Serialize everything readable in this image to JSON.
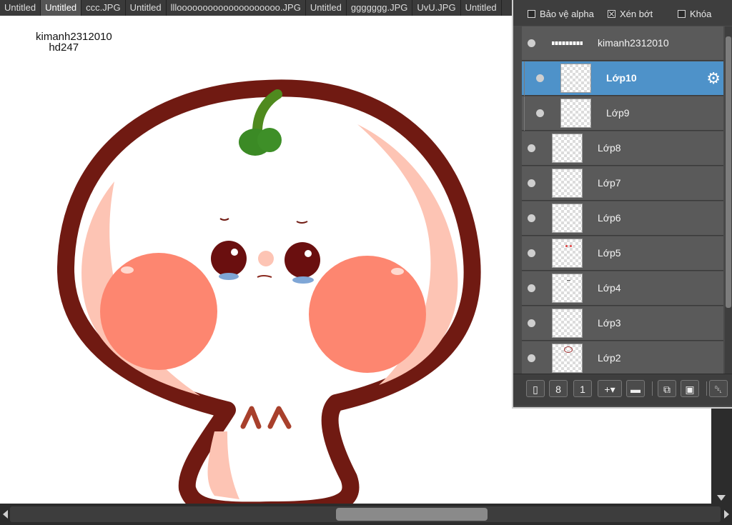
{
  "tabs": [
    {
      "label": "Untitled",
      "active": false
    },
    {
      "label": "Untitled",
      "active": true
    },
    {
      "label": "ccc.JPG",
      "active": false
    },
    {
      "label": "Untitled",
      "active": false
    },
    {
      "label": "llloooooooooooooooooooo.JPG",
      "active": false
    },
    {
      "label": "Untitled",
      "active": false
    },
    {
      "label": "ggggggg.JPG",
      "active": false
    },
    {
      "label": "UvU.JPG",
      "active": false
    },
    {
      "label": "Untitled",
      "active": false
    }
  ],
  "canvas": {
    "signature_line1": "kimanh2312010",
    "signature_line2": "hd247"
  },
  "layers_panel": {
    "options": {
      "alpha_protect": {
        "label": "Bảo vệ alpha",
        "checked": false
      },
      "clipping": {
        "label": "Xén bớt",
        "checked": true
      },
      "lock": {
        "label": "Khóa",
        "checked": false
      }
    },
    "layers": [
      {
        "name": "kimanh2312010",
        "selected": false,
        "in_folder": false,
        "thumb": "text"
      },
      {
        "name": "Lớp10",
        "selected": true,
        "in_folder": true,
        "thumb": "empty"
      },
      {
        "name": "Lớp9",
        "selected": false,
        "in_folder": true,
        "thumb": "empty"
      },
      {
        "name": "Lớp8",
        "selected": false,
        "in_folder": false,
        "thumb": "empty"
      },
      {
        "name": "Lớp7",
        "selected": false,
        "in_folder": false,
        "thumb": "empty"
      },
      {
        "name": "Lớp6",
        "selected": false,
        "in_folder": false,
        "thumb": "empty"
      },
      {
        "name": "Lớp5",
        "selected": false,
        "in_folder": false,
        "thumb": "dots"
      },
      {
        "name": "Lớp4",
        "selected": false,
        "in_folder": false,
        "thumb": "dash"
      },
      {
        "name": "Lớp3",
        "selected": false,
        "in_folder": false,
        "thumb": "empty"
      },
      {
        "name": "Lớp2",
        "selected": false,
        "in_folder": false,
        "thumb": "sketch"
      }
    ],
    "toolbar_icons": [
      "new-layer-icon",
      "new-8bit-layer-icon",
      "new-1bit-layer-icon",
      "add-layer-menu-icon",
      "folder-icon",
      "duplicate-layer-icon",
      "merge-layer-icon",
      "trash-icon"
    ]
  },
  "colors": {
    "selected_layer": "#4e92c9",
    "outline": "#701a12",
    "cheek": "#fd8670",
    "sprout": "#3b8a25"
  }
}
